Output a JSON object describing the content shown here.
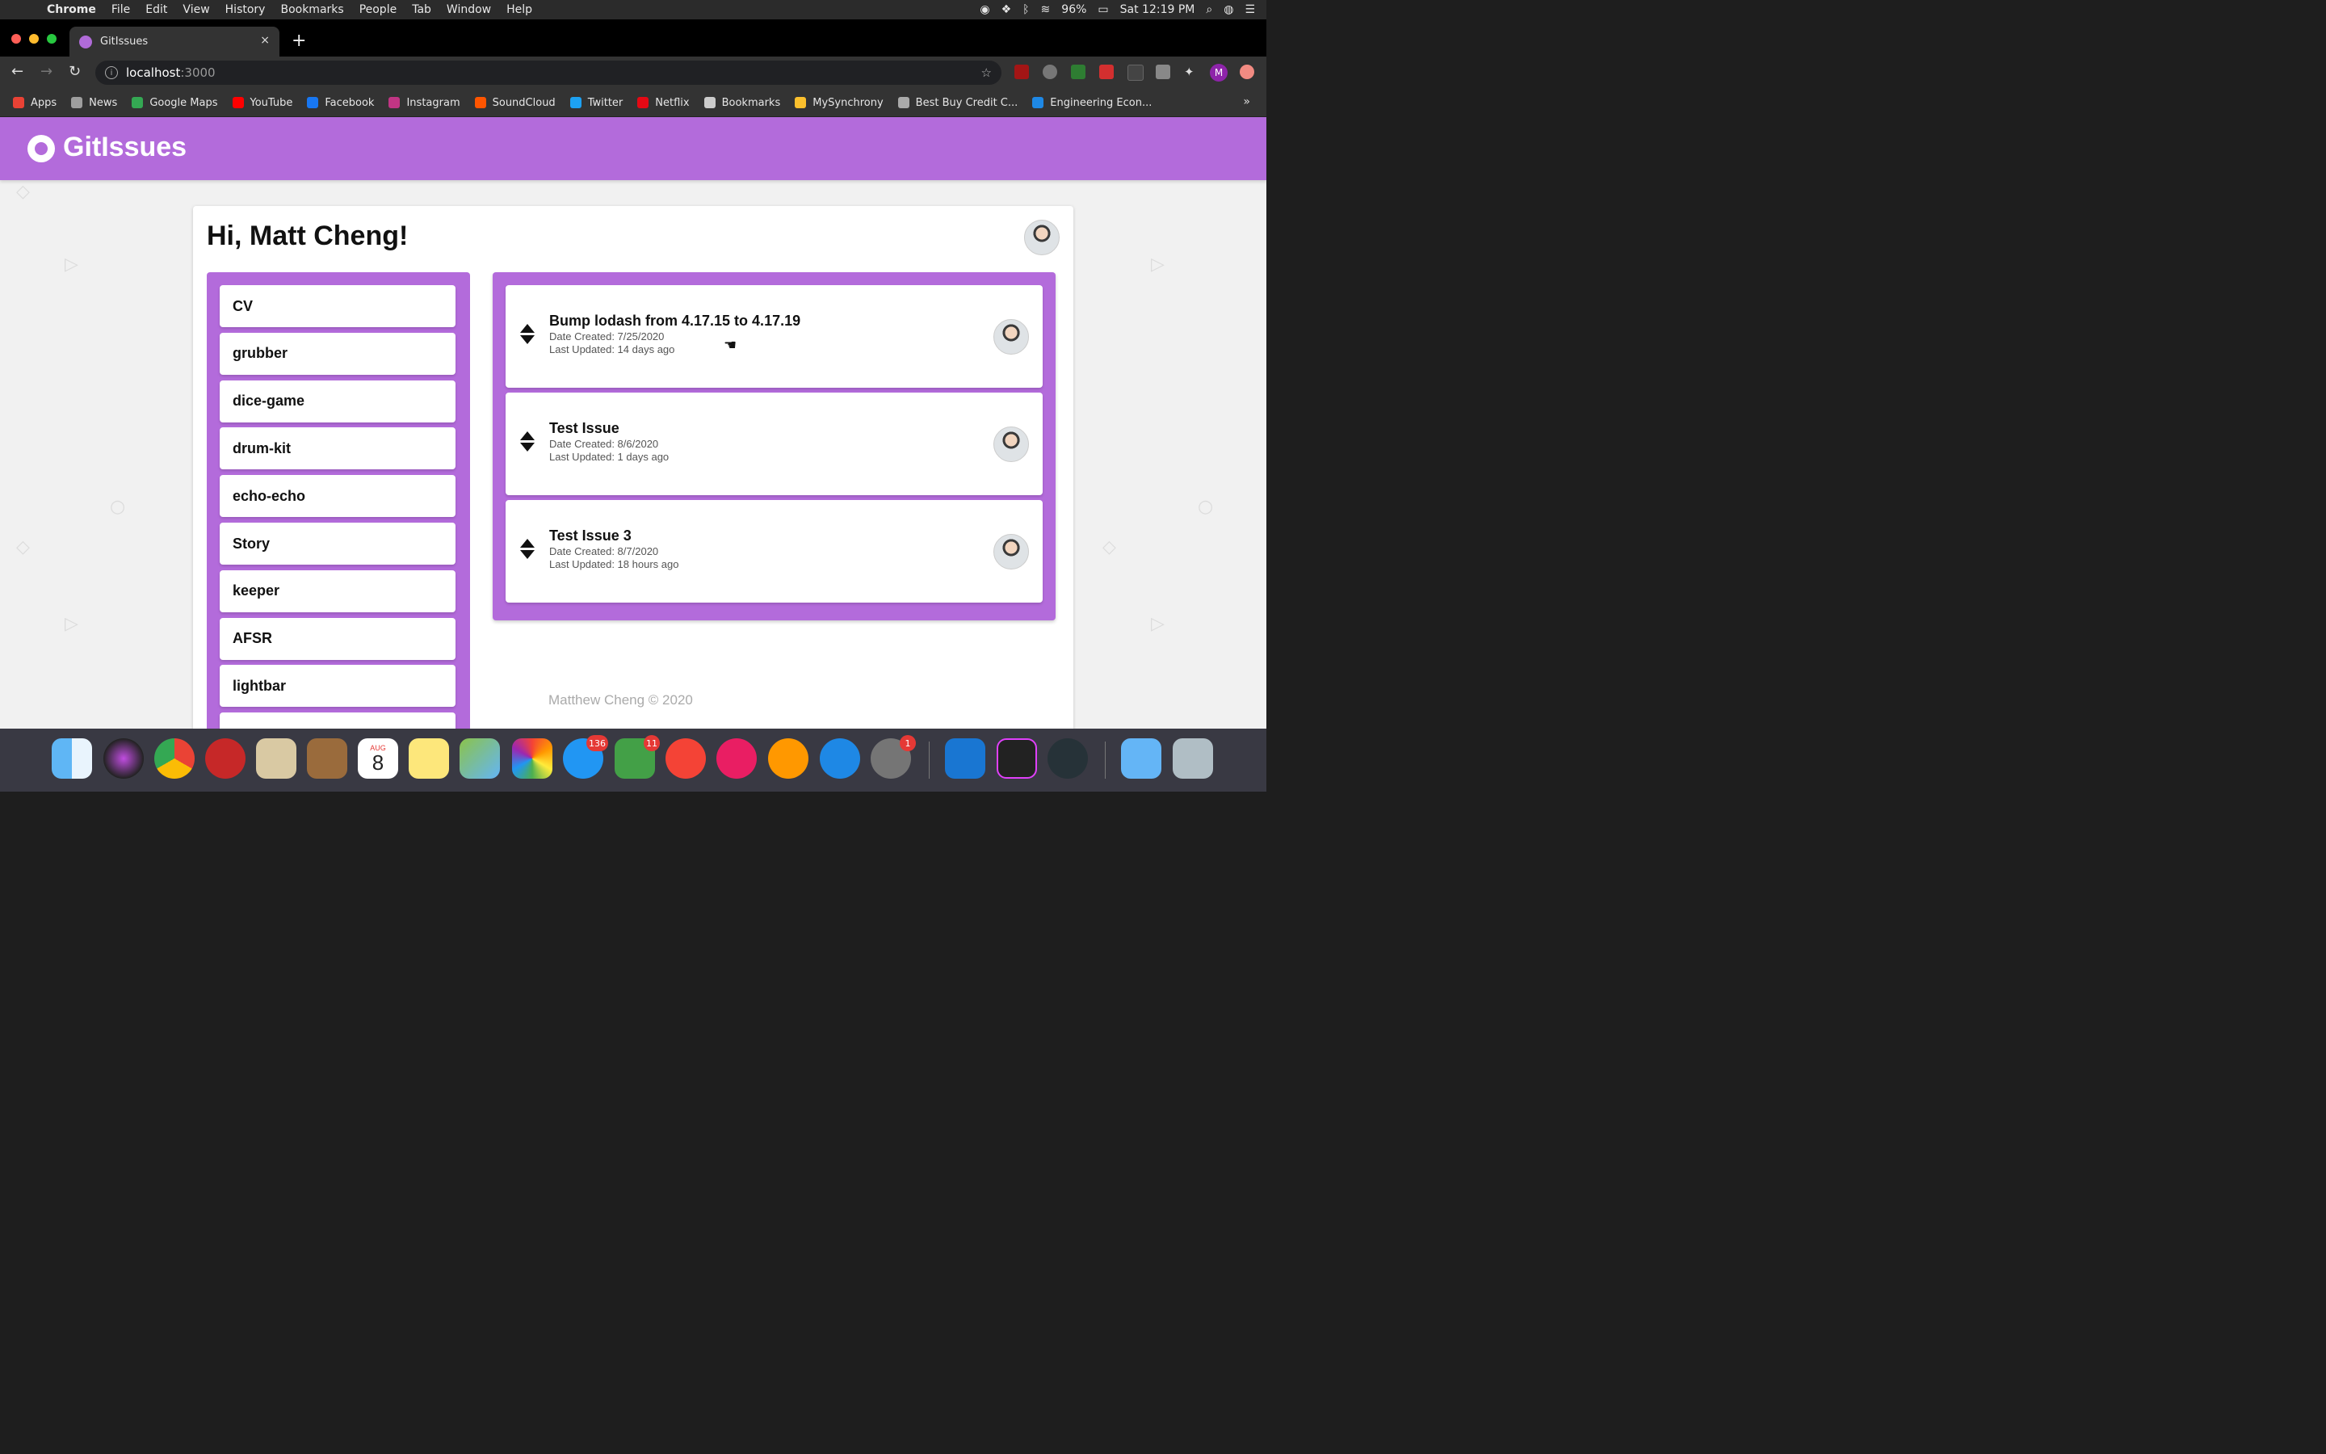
{
  "menubar": {
    "app": "Chrome",
    "items": [
      "File",
      "Edit",
      "View",
      "History",
      "Bookmarks",
      "People",
      "Tab",
      "Window",
      "Help"
    ],
    "battery": "96%",
    "clock": "Sat 12:19 PM"
  },
  "browser": {
    "tab_title": "GitIssues",
    "tab_close": "×",
    "new_tab": "+",
    "url_host": "localhost",
    "url_port": ":3000",
    "profile_initial": "M",
    "bookmarks": [
      {
        "label": "Apps",
        "color": "#e94235"
      },
      {
        "label": "News",
        "color": "#9e9e9e"
      },
      {
        "label": "Google Maps",
        "color": "#34a853"
      },
      {
        "label": "YouTube",
        "color": "#ff0000"
      },
      {
        "label": "Facebook",
        "color": "#1877f2"
      },
      {
        "label": "Instagram",
        "color": "#c13584"
      },
      {
        "label": "SoundCloud",
        "color": "#ff5500"
      },
      {
        "label": "Twitter",
        "color": "#1da1f2"
      },
      {
        "label": "Netflix",
        "color": "#e50914"
      },
      {
        "label": "Bookmarks",
        "color": "#cccccc"
      },
      {
        "label": "MySynchrony",
        "color": "#fbc02d"
      },
      {
        "label": "Best Buy Credit C...",
        "color": "#aaaaaa"
      },
      {
        "label": "Engineering Econ...",
        "color": "#1e88e5"
      }
    ],
    "bookmarks_more": "»"
  },
  "app": {
    "brand": "GitIssues",
    "greeting": "Hi, Matt Cheng!",
    "repos": [
      "CV",
      "grubber",
      "dice-game",
      "drum-kit",
      "echo-echo",
      "Story",
      "keeper",
      "AFSR",
      "lightbar"
    ],
    "issues": [
      {
        "title": "Bump lodash from 4.17.15 to 4.17.19",
        "created": "Date Created: 7/25/2020",
        "updated": "Last Updated: 14 days ago"
      },
      {
        "title": "Test Issue",
        "created": "Date Created: 8/6/2020",
        "updated": "Last Updated: 1 days ago"
      },
      {
        "title": "Test Issue 3",
        "created": "Date Created: 8/7/2020",
        "updated": "Last Updated: 18 hours ago"
      }
    ],
    "footer": "Matthew Cheng © 2020",
    "accent": "#b36bdb"
  },
  "dock": {
    "calendar_month": "AUG",
    "calendar_day": "8",
    "badges": {
      "messages": "136",
      "facetime": "11",
      "system_prefs": "1"
    }
  }
}
